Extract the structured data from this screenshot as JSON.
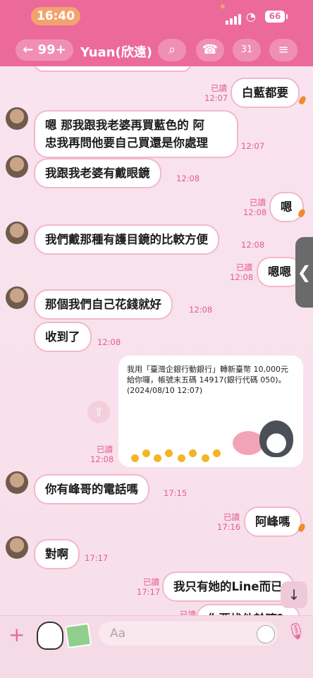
{
  "status_bar": {
    "time": "16:40",
    "battery": "66"
  },
  "header": {
    "back_count": "← 99+",
    "title": "Yuan(欣遠)",
    "icons": [
      "search-icon",
      "phone-icon",
      "calendar-icon",
      "menu-icon"
    ],
    "calendar_day": "31"
  },
  "messages": [
    {
      "id": "m1",
      "side": "right",
      "text": "白藍都要",
      "read": "已讀",
      "time": "12:07"
    },
    {
      "id": "m2",
      "side": "left",
      "text": "嗯 那我跟我老婆再買藍色的  阿\n忠我再問他要自己買還是你處理",
      "time": "12:07"
    },
    {
      "id": "m3",
      "side": "left",
      "text": "我跟我老婆有戴眼鏡",
      "time": "12:08"
    },
    {
      "id": "m4",
      "side": "right",
      "text": "嗯",
      "read": "已讀",
      "time": "12:08"
    },
    {
      "id": "m5",
      "side": "left",
      "text": "我們戴那種有護目鏡的比較方便",
      "time": "12:08"
    },
    {
      "id": "m6",
      "side": "right",
      "text": "嗯嗯",
      "read": "已讀",
      "time": "12:08"
    },
    {
      "id": "m7",
      "side": "left",
      "text": "那個我們自己花錢就好",
      "time": "12:08"
    },
    {
      "id": "m8",
      "side": "left",
      "text": "收到了",
      "time": "12:08"
    },
    {
      "id": "card",
      "side": "right",
      "read": "已讀",
      "time": "12:08",
      "text": "我用「臺灣企銀行動銀行」轉新臺幣 10,000元給你囉，帳號末五碼 14917(銀行代碼 050)。\n(2024/08/10 12:07)"
    },
    {
      "id": "m9",
      "side": "left",
      "text": "你有峰哥的電話嗎",
      "time": "17:15"
    },
    {
      "id": "m10",
      "side": "right",
      "text": "阿峰嗎",
      "read": "已讀",
      "time": "17:16"
    },
    {
      "id": "m11",
      "side": "left",
      "text": "對啊",
      "time": "17:17"
    },
    {
      "id": "m12",
      "side": "right",
      "text": "我只有她的Line而已",
      "read": "已讀",
      "time": "17:17"
    },
    {
      "id": "m13",
      "side": "right",
      "text": "你要找他幹嘛？",
      "read": "已讀",
      "time": ""
    }
  ],
  "input": {
    "placeholder": "Aa"
  },
  "colors": {
    "header": "#ec6a9a",
    "bubble_border": "#f2b7cf",
    "meta": "#e55b8e"
  }
}
